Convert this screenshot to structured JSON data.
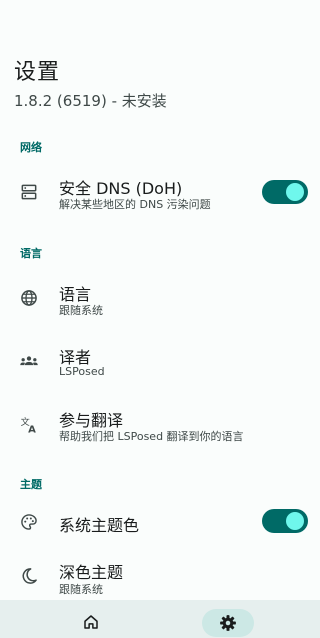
{
  "header": {
    "title": "设置",
    "subtitle": "1.8.2 (6519) - 未安装"
  },
  "sections": {
    "network": {
      "label": "网络",
      "dns": {
        "title": "安全 DNS (DoH)",
        "summary": "解决某些地区的 DNS 污染问题",
        "enabled": true,
        "icon": "dns-icon"
      }
    },
    "language": {
      "label": "语言",
      "language": {
        "title": "语言",
        "summary": "跟随系统",
        "icon": "globe-icon"
      },
      "translators": {
        "title": "译者",
        "summary": "LSPosed",
        "icon": "groups-icon"
      },
      "translate": {
        "title": "参与翻译",
        "summary": "帮助我们把 LSPosed 翻译到你的语言",
        "icon": "translate-icon"
      }
    },
    "theme": {
      "label": "主题",
      "system_color": {
        "title": "系统主题色",
        "enabled": true,
        "icon": "palette-icon"
      },
      "dark_theme": {
        "title": "深色主题",
        "summary": "跟随系统",
        "icon": "moon-icon"
      }
    }
  },
  "bottom_nav": {
    "items": [
      {
        "name": "home",
        "icon": "home-icon",
        "selected": false
      },
      {
        "name": "settings",
        "icon": "gear-icon",
        "selected": true
      }
    ]
  },
  "colors": {
    "accent": "#006a66",
    "switch_thumb": "#6ff7ec",
    "background": "#fafdfc",
    "nav_background": "#e6efee",
    "nav_pill": "#cce8e5"
  }
}
